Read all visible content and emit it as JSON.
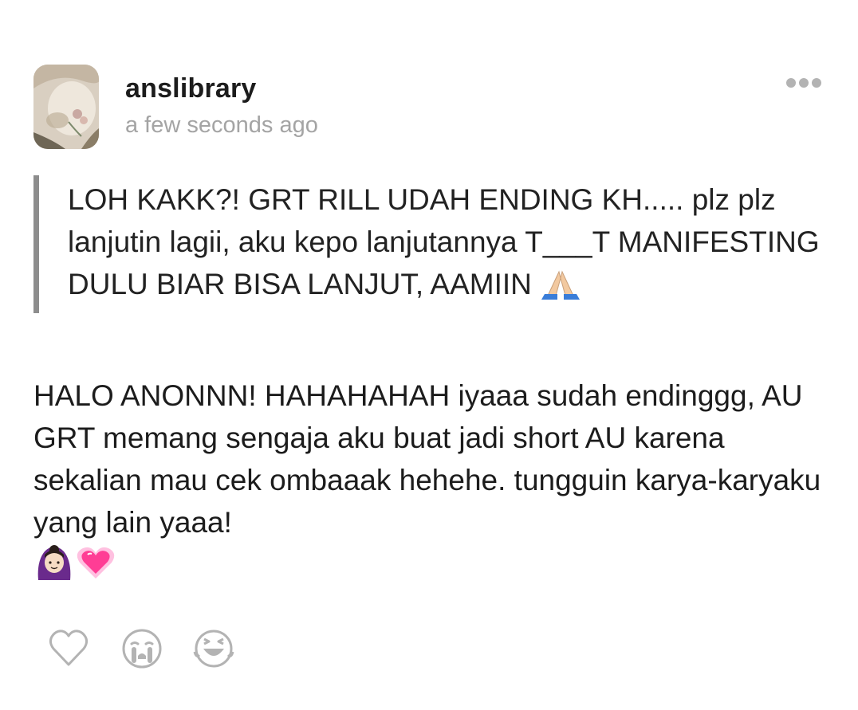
{
  "post": {
    "username": "anslibrary",
    "timestamp": "a few seconds ago",
    "question": {
      "text": "LOH KAKK?! GRT RILL UDAH ENDING KH..... plz plz lanjutin lagii, aku kepo lanjutannya T___T MANIFESTING DULU BIAR BISA LANJUT, AAMIIN",
      "trailing_emoji": "folded-hands-emoji"
    },
    "answer": {
      "text": "HALO ANONNN! HAHAHAHAH iyaaa sudah endinggg, AU GRT memang sengaja aku buat jadi short AU karena sekalian mau cek ombaaak hehehe. tungguin karya-karyaku yang lain yaaa!",
      "trailing_emojis": [
        "person-gesturing-ok-emoji",
        "sparkling-heart-emoji"
      ]
    },
    "actions": [
      {
        "name": "like",
        "icon": "heart-outline-icon"
      },
      {
        "name": "sad",
        "icon": "crying-face-icon"
      },
      {
        "name": "laugh",
        "icon": "laughing-face-icon"
      }
    ],
    "colors": {
      "username": "#1c1c1c",
      "timestamp": "#a4a4a4",
      "quote_bar": "#8d8d8d",
      "icons": "#b3b3b3"
    }
  }
}
